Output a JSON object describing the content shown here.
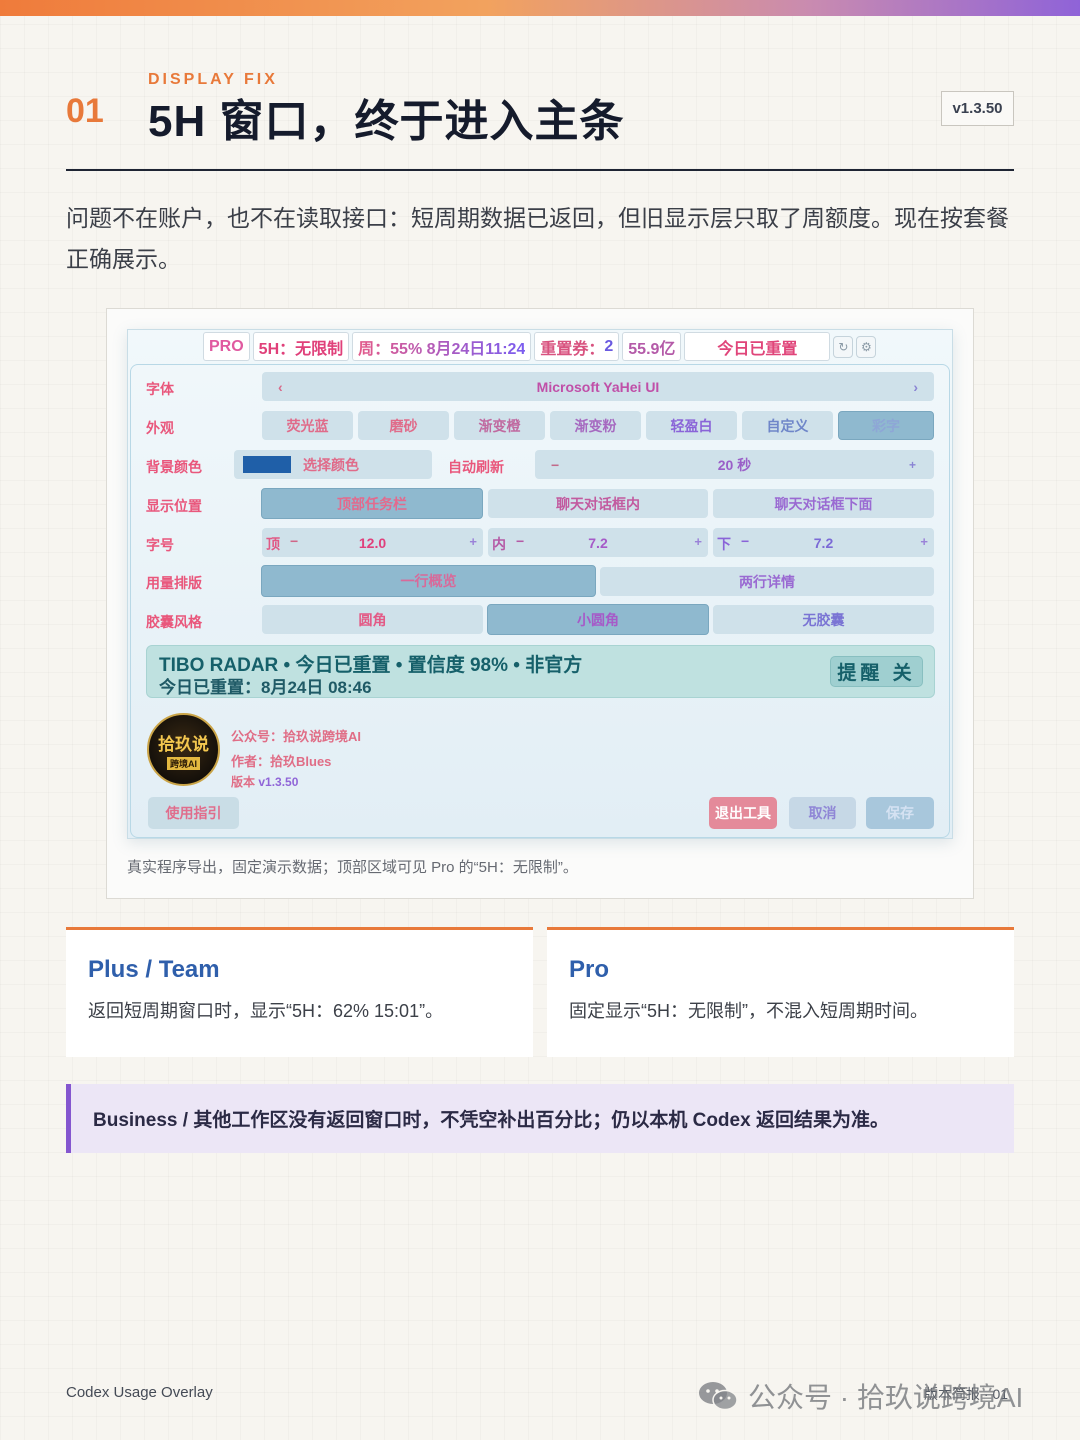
{
  "colors": {
    "accent": "#e8793a",
    "title": "#151b2c",
    "link_blue": "#2f5fab",
    "purple": "#8456cf"
  },
  "header": {
    "kicker": "DISPLAY FIX",
    "number": "01",
    "title": "5H 窗口，终于进入主条",
    "version": "v1.3.50"
  },
  "intro": "问题不在账户，也不在读取接口：短周期数据已返回，但旧显示层只取了周额度。现在按套餐正确展示。",
  "app": {
    "statusbar": {
      "plan": "PRO",
      "five_hour": "5H：无限制",
      "week": "周：55% 8月24日11:24",
      "coupon_label": "重置券：",
      "coupon_value": "2",
      "total": "55.9亿",
      "reset": "今日已重置",
      "icons": [
        "refresh-icon",
        "gear-icon"
      ]
    },
    "font_row": {
      "label": "字体",
      "prev": "‹",
      "value": "Microsoft YaHei UI",
      "next": "›"
    },
    "appearance_row": {
      "label": "外观",
      "options": [
        "荧光蓝",
        "磨砂",
        "渐变橙",
        "渐变粉",
        "轻盈白",
        "自定义",
        "彩字"
      ],
      "selected": "彩字"
    },
    "background_row": {
      "label": "背景颜色",
      "swatch_color": "#1f5fa8",
      "pick_label": "选择颜色",
      "auto_refresh_label": "自动刷新",
      "refresh_minus": "−",
      "refresh_value": "20 秒",
      "refresh_plus": "+"
    },
    "position_row": {
      "label": "显示位置",
      "options": [
        "顶部任务栏",
        "聊天对话框内",
        "聊天对话框下面"
      ],
      "selected": "顶部任务栏"
    },
    "fontsize_row": {
      "label": "字号",
      "top": {
        "label": "顶",
        "minus": "−",
        "value": "12.0",
        "plus": "+"
      },
      "inner": {
        "label": "内",
        "minus": "−",
        "value": "7.2",
        "plus": "+"
      },
      "lower": {
        "label": "下",
        "minus": "−",
        "value": "7.2",
        "plus": "+"
      }
    },
    "layout_row": {
      "label": "用量排版",
      "options": [
        "一行概览",
        "两行详情"
      ],
      "selected": "一行概览"
    },
    "capsule_row": {
      "label": "胶囊风格",
      "options": [
        "圆角",
        "小圆角",
        "无胶囊"
      ],
      "selected": "小圆角"
    },
    "radar": {
      "line1": "TIBO RADAR • 今日已重置 • 置信度 98% • 非官方",
      "line2": "今日已重置：8月24日 08:46",
      "remind_button": "提醒 关"
    },
    "about": {
      "logo_main": "拾玖说",
      "logo_sub": "跨境AI",
      "account": "公众号：拾玖说跨境AI",
      "author": "作者：拾玖Blues",
      "version_label": "版本",
      "version_value": "v1.3.50"
    },
    "buttons": {
      "guide": "使用指引",
      "exit": "退出工具",
      "cancel": "取消",
      "save": "保存"
    }
  },
  "caption": "真实程序导出，固定演示数据；顶部区域可见 Pro 的“5H：无限制”。",
  "cards": [
    {
      "title": "Plus / Team",
      "body": "返回短周期窗口时，显示“5H：62% 15:01”。"
    },
    {
      "title": "Pro",
      "body": "固定显示“5H：无限制”，不混入短周期时间。"
    }
  ],
  "note": "Business / 其他工作区没有返回窗口时，不凭空补出百分比；仍以本机 Codex 返回结果为准。",
  "footer": {
    "left": "Codex Usage Overlay",
    "right": "版本简报 · 01",
    "watermark": "公众号 · 拾玖说跨境AI"
  }
}
